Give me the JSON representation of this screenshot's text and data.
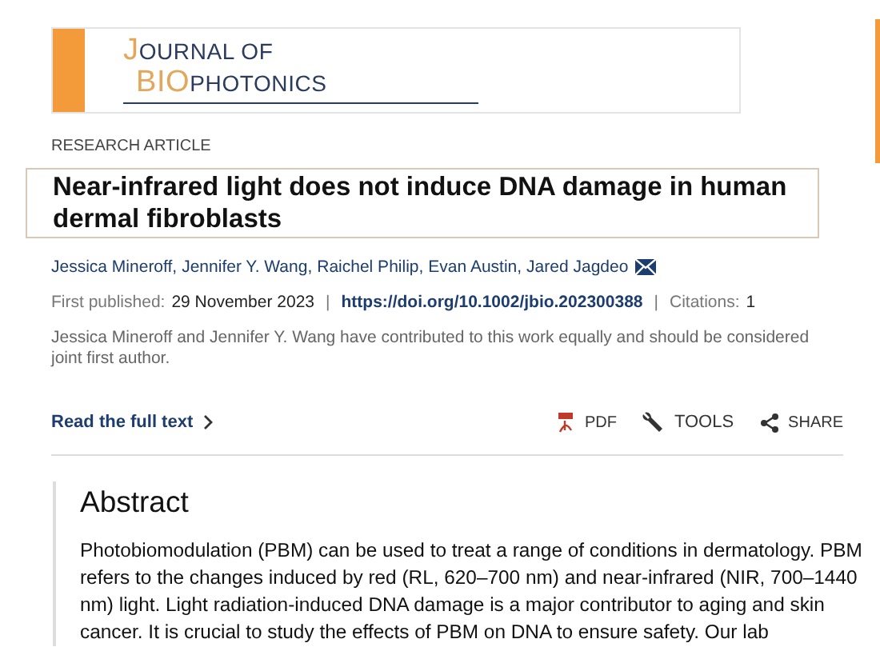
{
  "journal_logo": {
    "lines": [
      [
        {
          "text": "J",
          "accent": true
        },
        {
          "text": "OURNAL OF",
          "accent": false
        }
      ],
      [
        {
          "text": "BIO",
          "accent": true
        },
        {
          "text": "PHOTONICS",
          "accent": false
        }
      ]
    ]
  },
  "article_type": "RESEARCH ARTICLE",
  "title": "Near-infrared light does not induce DNA damage in human dermal fibroblasts",
  "authors": [
    "Jessica Mineroff,",
    "Jennifer Y. Wang,",
    "Raichel Philip,",
    "Evan Austin,",
    "Jared Jagdeo"
  ],
  "meta": {
    "published_label": "First published:",
    "published_date": "29 November 2023",
    "separator_1": "|",
    "doi": "https://doi.org/10.1002/jbio.202300388",
    "separator_2": "|",
    "citations_label": "Citations:",
    "citations": "1"
  },
  "note": "Jessica Mineroff and Jennifer Y. Wang have contributed to this work equally and should be considered joint first author.",
  "read_full_text": "Read the full text",
  "actions": [
    {
      "kind": "pdf",
      "label": "PDF"
    },
    {
      "kind": "tools",
      "label": "TOOLS"
    },
    {
      "kind": "share",
      "label": "SHARE"
    }
  ],
  "abstract": {
    "heading": "Abstract",
    "text": "Photobiomodulation (PBM) can be used to treat a range of conditions in dermatology. PBM refers to the changes induced by red (RL, 620–700 nm) and near-infrared (NIR, 700–1440 nm) light. Light radiation-induced DNA damage is a major contributor to aging and skin cancer. It is crucial to study the effects of PBM on DNA to ensure safety. Our lab"
  }
}
